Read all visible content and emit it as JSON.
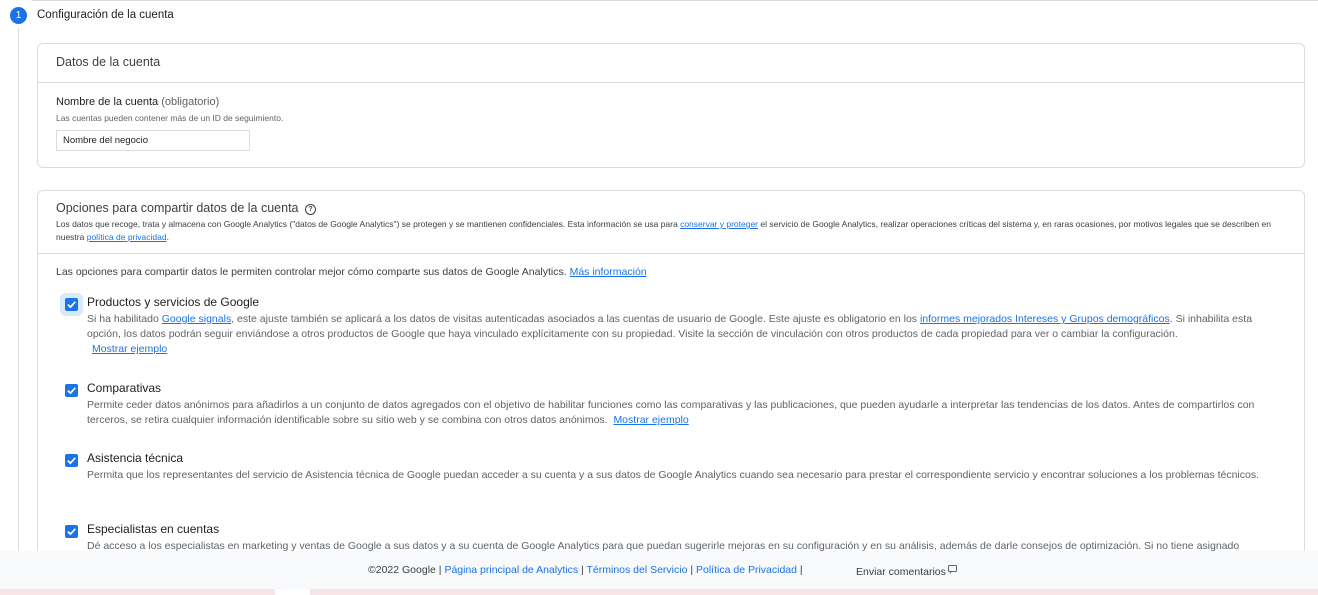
{
  "step": {
    "number": "1",
    "title": "Configuración de la cuenta"
  },
  "account_data": {
    "title": "Datos de la cuenta",
    "name_label": "Nombre de la cuenta",
    "name_optional": "(obligatorio)",
    "name_help": "Las cuentas pueden contener más de un ID de seguimiento.",
    "name_value": "Nombre del negocio"
  },
  "sharing": {
    "title": "Opciones para compartir datos de la cuenta",
    "help_icon": "?",
    "desc_1": "Los datos que recoge, trata y almacena con Google Analytics (\"datos de Google Analytics\") se protegen y se mantienen confidenciales. Esta información se usa para ",
    "desc_link_1": "conservar y proteger",
    "desc_2": " el servicio de Google Analytics, realizar operaciones críticas del sistema y, en raras ocasiones, por motivos legales que se describen en nuestra ",
    "desc_link_2": "política de privacidad",
    "desc_3": ".",
    "intro": "Las opciones para compartir datos le permiten controlar mejor cómo comparte sus datos de Google Analytics. ",
    "intro_link": "Más información",
    "options": [
      {
        "title": "Productos y servicios de Google",
        "checked": true,
        "text_1": "Si ha habilitado ",
        "link_1": "Google signals",
        "text_2": ", este ajuste también se aplicará a los datos de visitas autenticadas asociados a las cuentas de usuario de Google. Este ajuste es obligatorio en los ",
        "link_2": "informes mejorados Intereses y Grupos demográficos",
        "text_3": ". Si inhabilita esta opción, los datos podrán seguir enviándose a otros productos de Google que haya vinculado explícitamente con su propiedad. Visite la sección de vinculación con otros productos de cada propiedad para ver o cambiar la configuración.",
        "example_link": "Mostrar ejemplo"
      },
      {
        "title": "Comparativas",
        "checked": true,
        "text_1": "Permite ceder datos anónimos para añadirlos a un conjunto de datos agregados con el objetivo de habilitar funciones como las comparativas y las publicaciones, que pueden ayudarle a interpretar las tendencias de los datos. Antes de compartirlos con terceros, se retira cualquier información identificable sobre su sitio web y se combina con otros datos anónimos.",
        "example_link": "Mostrar ejemplo"
      },
      {
        "title": "Asistencia técnica",
        "checked": true,
        "text_1": "Permita que los representantes del servicio de Asistencia técnica de Google puedan acceder a su cuenta y a sus datos de Google Analytics cuando sea necesario para prestar el correspondiente servicio y encontrar soluciones a los problemas técnicos."
      },
      {
        "title": "Especialistas en cuentas",
        "checked": true,
        "text_1": "Dé acceso a los especialistas en marketing y ventas de Google a sus datos y a su cuenta de Google Analytics para que puedan sugerirle mejoras en su configuración y en su análisis, además de darle consejos de optimización. Si no tiene asignado"
      }
    ]
  },
  "footer": {
    "copyright": "©2022 Google | ",
    "link_home": "Página principal de Analytics",
    "sep": " | ",
    "link_terms": "Términos del Servicio",
    "link_privacy": "Política de Privacidad",
    "end_sep": " |",
    "feedback": "Enviar comentarios",
    "feedback_icon": "feedback-icon"
  },
  "colors": {
    "accent": "#1a73e8",
    "border": "#dadce0",
    "footer_bg": "#f8f9fa"
  }
}
